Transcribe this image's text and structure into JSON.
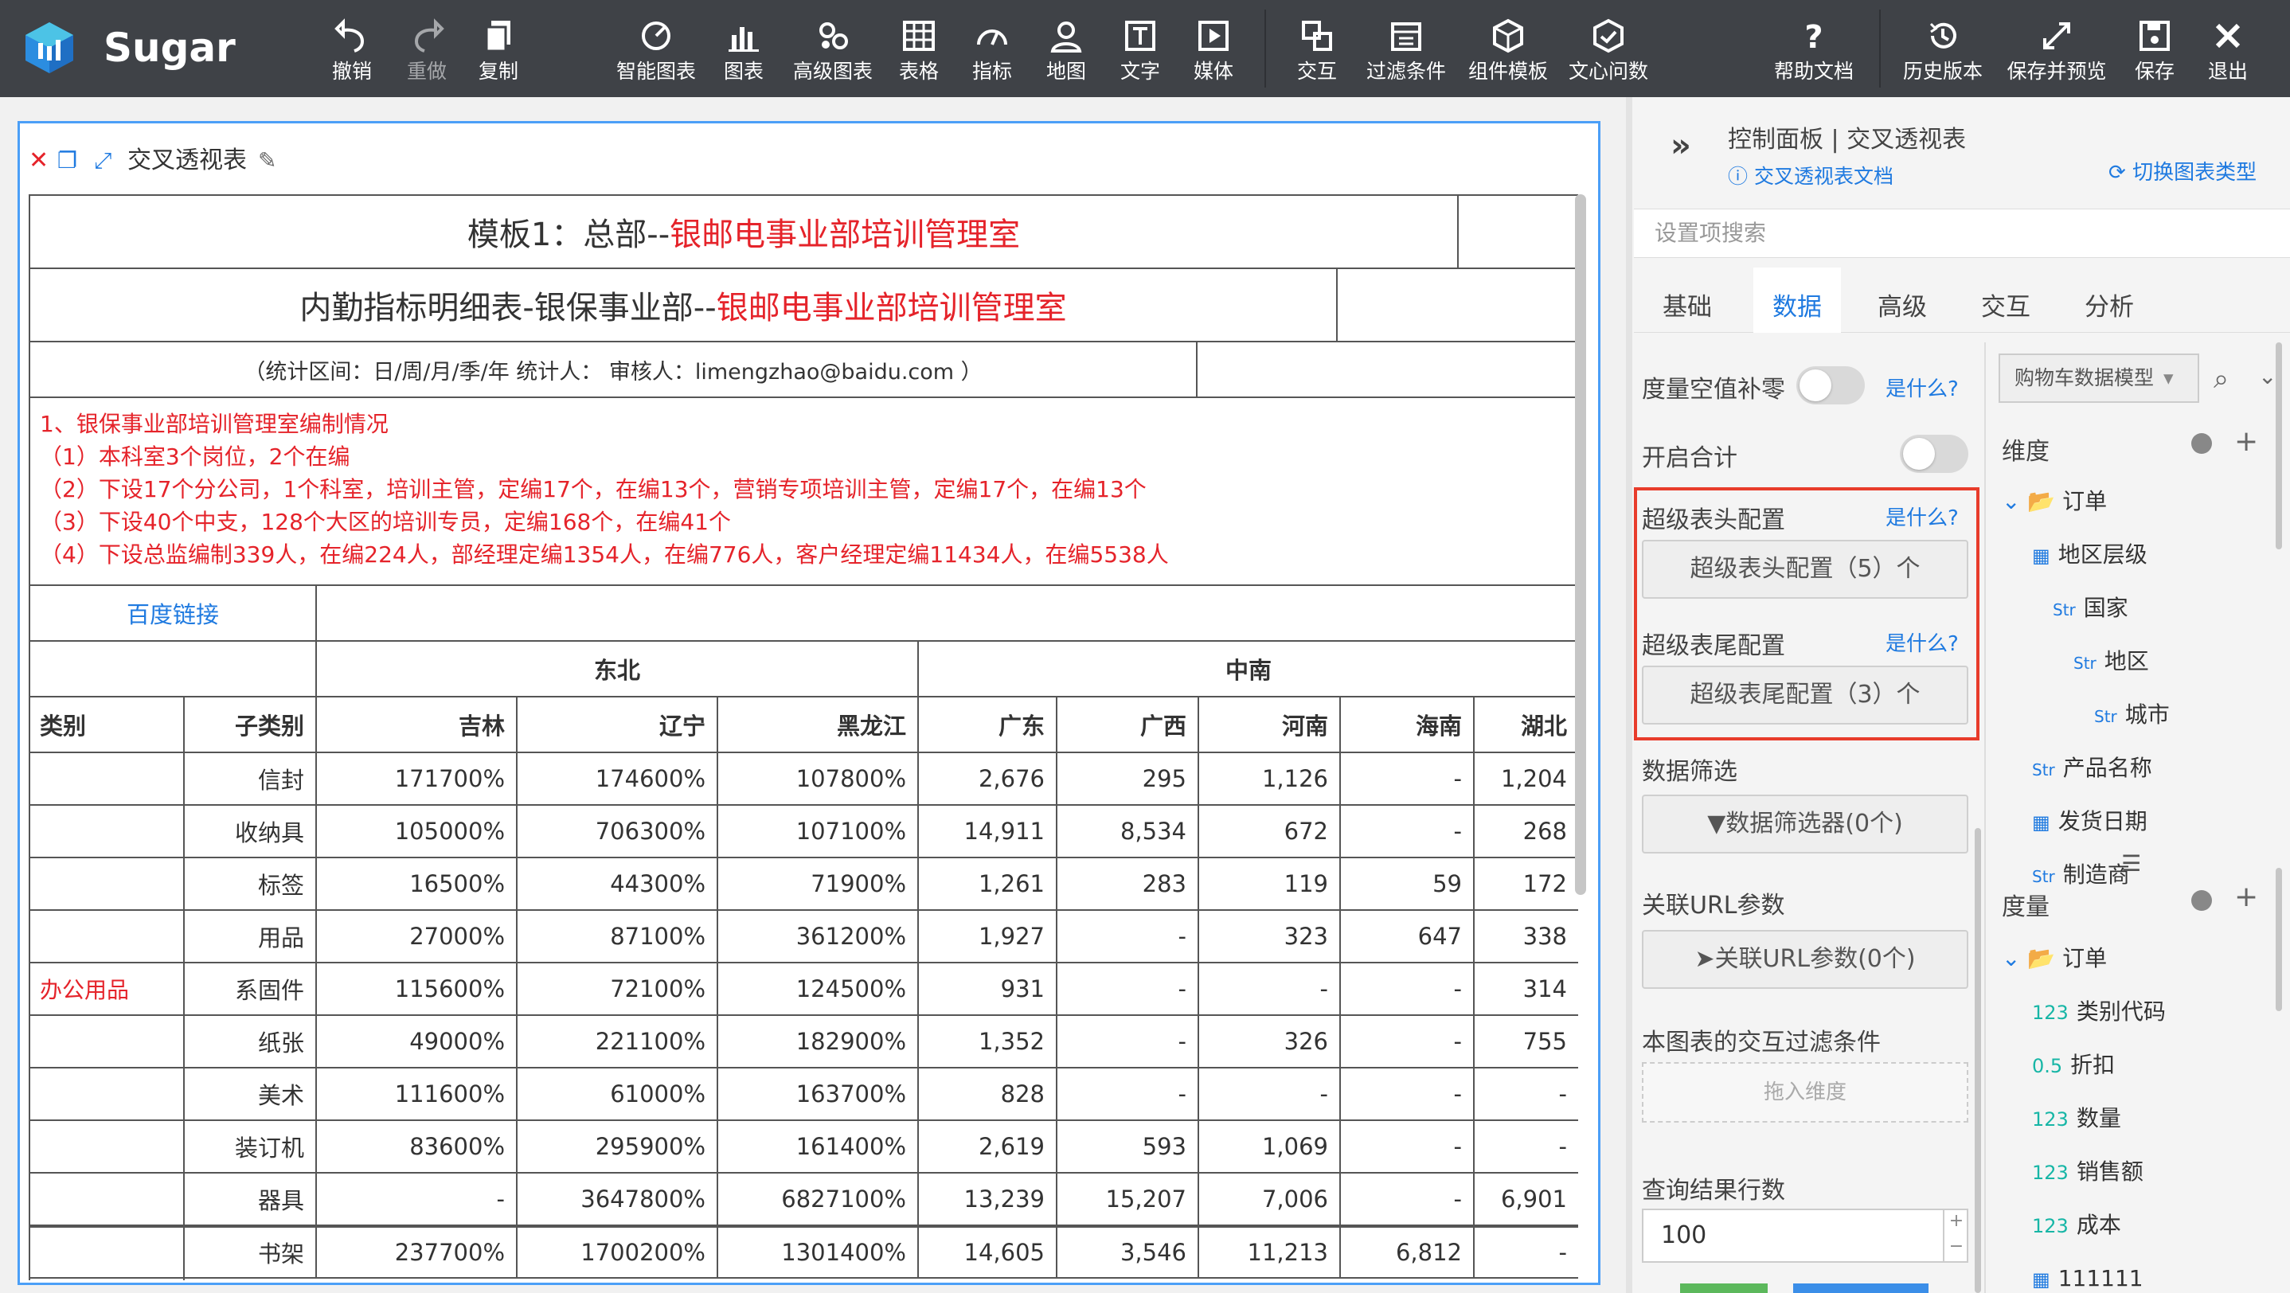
{
  "app": {
    "name": "Sugar"
  },
  "toolbar": {
    "items": [
      {
        "label": "撤销",
        "icon": "undo-icon"
      },
      {
        "label": "重做",
        "icon": "redo-icon"
      },
      {
        "label": "复制",
        "icon": "copy-icon"
      },
      {
        "label": "智能图表",
        "icon": "smart-chart-icon"
      },
      {
        "label": "图表",
        "icon": "bar-chart-icon"
      },
      {
        "label": "高级图表",
        "icon": "advanced-chart-icon"
      },
      {
        "label": "表格",
        "icon": "table-icon"
      },
      {
        "label": "指标",
        "icon": "gauge-icon"
      },
      {
        "label": "地图",
        "icon": "map-pin-icon"
      },
      {
        "label": "文字",
        "icon": "text-icon"
      },
      {
        "label": "媒体",
        "icon": "media-icon"
      },
      {
        "label": "交互",
        "icon": "interaction-icon"
      },
      {
        "label": "过滤条件",
        "icon": "filter-calendar-icon"
      },
      {
        "label": "组件模板",
        "icon": "cube-icon"
      },
      {
        "label": "文心问数",
        "icon": "ai-hex-icon"
      },
      {
        "label": "帮助文档",
        "icon": "help-icon"
      },
      {
        "label": "历史版本",
        "icon": "history-icon"
      },
      {
        "label": "保存并预览",
        "icon": "expand-icon"
      },
      {
        "label": "保存",
        "icon": "save-icon"
      },
      {
        "label": "退出",
        "icon": "close-icon"
      }
    ]
  },
  "chart": {
    "title": "交叉透视表",
    "header1_black": "模板1：总部--",
    "header1_red": "银邮电事业部培训管理室",
    "header2_black": "内勤指标明细表-银保事业部--",
    "header2_red": "银邮电事业部培训管理室",
    "stat_line": "（统计区间：日/周/月/季/年 统计人：  审核人：limengzhao@baidu.com ）",
    "notes": [
      "1、银保事业部培训管理室编制情况",
      "（1）本科室3个岗位，2个在编",
      "（2）下设17个分公司，1个科室，培训主管，定编17个，在编13个，营销专项培训主管，定编17个，在编13个",
      "（3）下设40个中支，128个大区的培训专员，定编168个，在编41个",
      "（4）下设总监编制339人，在编224人，部经理定编1354人，在编776人，客户经理定编11434人，在编5538人"
    ],
    "link_text": "百度链接",
    "regions": [
      "东北",
      "中南"
    ],
    "columns": [
      "类别",
      "子类别",
      "吉林",
      "辽宁",
      "黑龙江",
      "广东",
      "广西",
      "河南",
      "海南",
      "湖北"
    ],
    "category": "办公用品",
    "rows": [
      [
        "信封",
        "171700%",
        "174600%",
        "107800%",
        "2,676",
        "295",
        "1,126",
        "-",
        "1,204"
      ],
      [
        "收纳具",
        "105000%",
        "706300%",
        "107100%",
        "14,911",
        "8,534",
        "672",
        "-",
        "268"
      ],
      [
        "标签",
        "16500%",
        "44300%",
        "71900%",
        "1,261",
        "283",
        "119",
        "59",
        "172"
      ],
      [
        "用品",
        "27000%",
        "87100%",
        "361200%",
        "1,927",
        "-",
        "323",
        "647",
        "338"
      ],
      [
        "系固件",
        "115600%",
        "72100%",
        "124500%",
        "931",
        "-",
        "-",
        "-",
        "314"
      ],
      [
        "纸张",
        "49000%",
        "221100%",
        "182900%",
        "1,352",
        "-",
        "326",
        "-",
        "755"
      ],
      [
        "美术",
        "111600%",
        "61000%",
        "163700%",
        "828",
        "-",
        "-",
        "-",
        "-"
      ],
      [
        "装订机",
        "83600%",
        "295900%",
        "161400%",
        "2,619",
        "593",
        "1,069",
        "-",
        "-"
      ],
      [
        "器具",
        "-",
        "3647800%",
        "6827100%",
        "13,239",
        "15,207",
        "7,006",
        "-",
        "6,901"
      ],
      [
        "书架",
        "237700%",
        "1700200%",
        "1301400%",
        "14,605",
        "3,546",
        "11,213",
        "6,812",
        "-"
      ]
    ]
  },
  "panel": {
    "title": "控制面板 | 交叉透视表",
    "doc_link": "交叉透视表文档",
    "switch_type": "切换图表类型",
    "search_placeholder": "设置项搜索",
    "tabs": [
      "基础",
      "数据",
      "高级",
      "交互",
      "分析"
    ],
    "active_tab": "数据",
    "null_fill_label": "度量空值补零",
    "what": "是什么?",
    "total_label": "开启合计",
    "super_header_label": "超级表头配置",
    "super_header_btn": "超级表头配置（5）个",
    "super_footer_label": "超级表尾配置",
    "super_footer_btn": "超级表尾配置（3）个",
    "data_filter_label": "数据筛选",
    "data_filter_btn": "数据筛选器(0个)",
    "url_param_label": "关联URL参数",
    "url_param_btn": "关联URL参数(0个)",
    "interaction_filter_label": "本图表的交互过滤条件",
    "drop_dimension": "拖入维度",
    "query_rows_label": "查询结果行数",
    "query_rows_value": "100",
    "model": "购物车数据模型",
    "dimension_label": "维度",
    "measure_label": "度量",
    "dimension_tree": [
      {
        "label": "订单",
        "tag": ""
      },
      {
        "label": "地区层级",
        "tag": ""
      },
      {
        "label": "国家",
        "tag": "Str"
      },
      {
        "label": "地区",
        "tag": "Str"
      },
      {
        "label": "城市",
        "tag": "Str"
      },
      {
        "label": "产品名称",
        "tag": "Str"
      },
      {
        "label": "发货日期",
        "tag": ""
      },
      {
        "label": "制造商",
        "tag": "Str"
      }
    ],
    "measure_tree": [
      {
        "label": "订单",
        "tag": ""
      },
      {
        "label": "类别代码",
        "tag": "123"
      },
      {
        "label": "折扣",
        "tag": "0.5"
      },
      {
        "label": "数量",
        "tag": "123"
      },
      {
        "label": "销售额",
        "tag": "123"
      },
      {
        "label": "成本",
        "tag": "123"
      },
      {
        "label": "111111",
        "tag": ""
      }
    ]
  }
}
